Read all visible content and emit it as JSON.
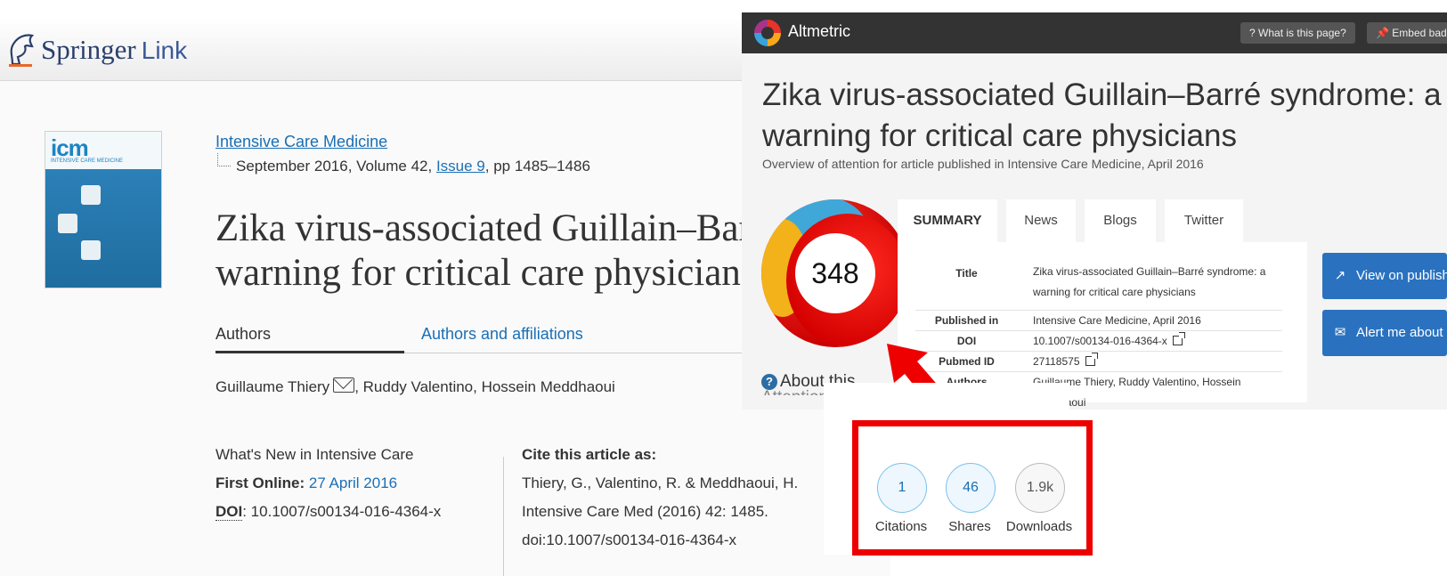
{
  "springer": {
    "logo_name": "Springer",
    "logo_link": "Link",
    "journal": "Intensive Care Medicine",
    "issue_prefix": "September 2016, Volume 42, ",
    "issue_link": "Issue 9",
    "issue_pages": ", pp 1485–1486",
    "title_line1": "Zika virus-associated Guillain–Barré syndrome: a",
    "title_line2": "warning for critical care physicians",
    "tabs": [
      {
        "label": "Authors"
      },
      {
        "label": "Authors and affiliations"
      }
    ],
    "author1": "Guillaume Thiery",
    "authors_rest": ", Ruddy Valentino, Hossein Meddhaoui",
    "whats_new": "What's New in Intensive Care",
    "first_online_label": "First Online:",
    "first_online_value": "27 April 2016",
    "doi_label": "DOI",
    "doi_value": ": 10.1007/s00134-016-4364-x",
    "cite_heading": "Cite this article as:",
    "cite_lines": [
      "Thiery, G., Valentino, R. & Meddhaoui, H.",
      "Intensive Care Med (2016) 42: 1485.",
      "doi:10.1007/s00134-016-4364-x"
    ],
    "cover": {
      "logo": "icm",
      "subtitle": "INTENSIVE CARE MEDICINE"
    }
  },
  "altmetric": {
    "brand": "Altmetric",
    "header_buttons": [
      {
        "label": "What is this page?"
      },
      {
        "label": "Embed badge"
      }
    ],
    "title_line1": "Zika virus-associated Guillain–Barré syndrome: a",
    "title_line2": "warning for critical care physicians",
    "overview": "Overview of attention for article published in Intensive Care Medicine, April 2016",
    "score": "348",
    "about": "About this",
    "about_line2": "Attention Score",
    "tabs": [
      {
        "label": "SUMMARY"
      },
      {
        "label": "News"
      },
      {
        "label": "Blogs"
      },
      {
        "label": "Twitter"
      }
    ],
    "summary": [
      {
        "label": "Title",
        "value": "Zika virus-associated Guillain–Barré syndrome: a warning for critical care physicians"
      },
      {
        "label": "Published in",
        "value": "Intensive Care Medicine, April 2016"
      },
      {
        "label": "DOI",
        "value": "10.1007/s00134-016-4364-x"
      },
      {
        "label": "Pubmed ID",
        "value": "27118575"
      },
      {
        "label": "Authors",
        "value": "Guillaume Thiery, Ruddy Valentino, Hossein Meddhaoui"
      }
    ],
    "side_buttons": [
      {
        "label": "View on publisher site"
      },
      {
        "label": "Alert me about new mentions"
      }
    ]
  },
  "metrics": [
    {
      "value": "1",
      "label": "Citations"
    },
    {
      "value": "46",
      "label": "Shares"
    },
    {
      "value": "1.9k",
      "label": "Downloads"
    }
  ],
  "colors": {
    "highlight": "#ee0000",
    "springer_link": "#1a6fb5",
    "altmetric_header": "#333333",
    "button_blue": "#2a72c0"
  }
}
